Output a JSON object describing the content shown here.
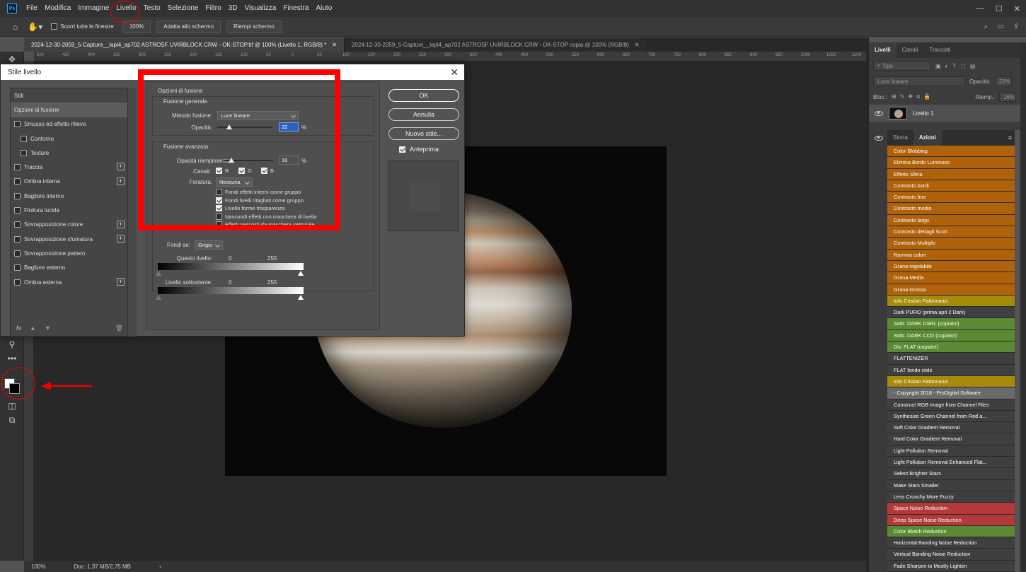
{
  "menubar": {
    "logo": "Ps",
    "items": [
      "File",
      "Modifica",
      "Immagine",
      "Livello",
      "Testo",
      "Selezione",
      "Filtro",
      "3D",
      "Visualizza",
      "Finestra",
      "Aiuto"
    ]
  },
  "options": {
    "scroll_all": "Scorri tutte le finestre",
    "zoom": "100%",
    "fit_screen": "Adatta allo schermo",
    "fill_screen": "Riempi schermo"
  },
  "tabs": [
    {
      "label": "2024-12-30-2059_5-Capture__lapl4_ap702 ASTROSF UVIRBLOCK CRW - OK-STOP.tif @ 100% (Livello 1, RGB/8) *",
      "active": true
    },
    {
      "label": "2024-12-30-2059_5-Capture__lapl4_ap702 ASTROSF UVIRBLOCK CRW - OK-STOP copia @ 100% (RGB/8)",
      "active": false
    }
  ],
  "ruler_ticks": [
    "500",
    "450",
    "400",
    "350",
    "300",
    "250",
    "200",
    "150",
    "100",
    "50",
    "0",
    "50",
    "100",
    "150",
    "200",
    "250",
    "300",
    "350",
    "400",
    "450",
    "500",
    "550",
    "600",
    "650",
    "700",
    "750",
    "800",
    "850",
    "900",
    "950",
    "1000",
    "1050",
    "1100"
  ],
  "status": {
    "zoom": "100%",
    "doc": "Doc: 1,37 MB/2,75 MB"
  },
  "layers_panel": {
    "tabs": [
      "Livelli",
      "Canali",
      "Tracciati"
    ],
    "filter_placeholder": "Tipo",
    "blend_mode": "Luce lineare",
    "opacity_label": "Opacità:",
    "opacity_value": "22%",
    "lock_label": "Bloc.:",
    "fill_label": "Riemp.:",
    "fill_value": "16%",
    "layer_name": "Livello 1"
  },
  "actions_panel": {
    "tabs": [
      "Storia",
      "Azioni"
    ],
    "items": [
      {
        "label": "Color Blobbing",
        "color": "#b0620b"
      },
      {
        "label": "Elimina Bordo Luminoso",
        "color": "#b0620b"
      },
      {
        "label": "Effetto Sfera",
        "color": "#b0620b"
      },
      {
        "label": "Contrasto bordi",
        "color": "#b0620b"
      },
      {
        "label": "Contrasto fine",
        "color": "#b0620b"
      },
      {
        "label": "Contrasto medio",
        "color": "#b0620b"
      },
      {
        "label": "Contrasto largo",
        "color": "#b0620b"
      },
      {
        "label": "Contrasto dettagli Scuri",
        "color": "#b0620b"
      },
      {
        "label": "Contrasto Multiplo",
        "color": "#b0620b"
      },
      {
        "label": "Ravviva colori",
        "color": "#b0620b"
      },
      {
        "label": "Grana regolabile",
        "color": "#b0620b"
      },
      {
        "label": "Grana Media",
        "color": "#b0620b"
      },
      {
        "label": "Grana Grossa",
        "color": "#b0620b"
      },
      {
        "label": "Info Cristian Fattinnanzi",
        "color": "#a68a0a"
      },
      {
        "label": "Dark PURO (prima apri 2 Dark)",
        "color": "#3f3f3f"
      },
      {
        "label": "Sottr. DARK DSRL (copialo!)",
        "color": "#5c8a34"
      },
      {
        "label": "Sottr. DARK CCD (copialo!)",
        "color": "#5c8a34"
      },
      {
        "label": "Div. FLAT (copialo!)",
        "color": "#5c8a34"
      },
      {
        "label": "FLATTENIZER",
        "color": "#3f3f3f"
      },
      {
        "label": "FLAT fondo cielo",
        "color": "#3f3f3f"
      },
      {
        "label": "Info Cristian Fattinnanzi",
        "color": "#a68a0a"
      },
      {
        "label": "- Copyright 2018 - ProDigital Software",
        "color": "#6a6a6a"
      },
      {
        "label": "Construct RGB Image from Channel Files",
        "color": "#3f3f3f"
      },
      {
        "label": "Synthesize Green Channel from Red a...",
        "color": "#3f3f3f"
      },
      {
        "label": "Soft Color Gradient Removal",
        "color": "#3f3f3f"
      },
      {
        "label": "Hard Color Gradient Removal",
        "color": "#3f3f3f"
      },
      {
        "label": "Light Pollution Removal",
        "color": "#3f3f3f"
      },
      {
        "label": "Light Pollution Removal Enhanced Flat...",
        "color": "#3f3f3f"
      },
      {
        "label": "Select Brighter Stars",
        "color": "#3f3f3f"
      },
      {
        "label": "Make Stars Smaller",
        "color": "#3f3f3f"
      },
      {
        "label": "Less Crunchy More Fuzzy",
        "color": "#3f3f3f"
      },
      {
        "label": "Space Noise Reduction",
        "color": "#b33a3a"
      },
      {
        "label": "Deep Space Noise Reduction",
        "color": "#b33a3a"
      },
      {
        "label": "Color Blotch Reduction",
        "color": "#5c8a34"
      },
      {
        "label": "Horizontal Banding Noise Reduction",
        "color": "#3f3f3f"
      },
      {
        "label": "Vertical Banding Noise Reduction",
        "color": "#3f3f3f"
      },
      {
        "label": "Fade Sharpen to Mostly Lighten",
        "color": "#3f3f3f"
      }
    ]
  },
  "dialog": {
    "title": "Stile livello",
    "styles": [
      {
        "label": "Stili",
        "checkbox": false,
        "sub": false,
        "plus": false,
        "selected": false
      },
      {
        "label": "Opzioni di fusione",
        "checkbox": false,
        "sub": false,
        "plus": false,
        "selected": true
      },
      {
        "label": "Smusso ed effetto rilievo",
        "checkbox": true,
        "sub": false,
        "plus": false,
        "selected": false
      },
      {
        "label": "Contorno",
        "checkbox": true,
        "sub": true,
        "plus": false,
        "selected": false
      },
      {
        "label": "Texture",
        "checkbox": true,
        "sub": true,
        "plus": false,
        "selected": false
      },
      {
        "label": "Traccia",
        "checkbox": true,
        "sub": false,
        "plus": true,
        "selected": false
      },
      {
        "label": "Ombra interna",
        "checkbox": true,
        "sub": false,
        "plus": true,
        "selected": false
      },
      {
        "label": "Bagliore interno",
        "checkbox": true,
        "sub": false,
        "plus": false,
        "selected": false
      },
      {
        "label": "Finitura lucida",
        "checkbox": true,
        "sub": false,
        "plus": false,
        "selected": false
      },
      {
        "label": "Sovrapposizione colore",
        "checkbox": true,
        "sub": false,
        "plus": true,
        "selected": false
      },
      {
        "label": "Sovrapposizione sfumatura",
        "checkbox": true,
        "sub": false,
        "plus": true,
        "selected": false
      },
      {
        "label": "Sovrapposizione pattern",
        "checkbox": true,
        "sub": false,
        "plus": false,
        "selected": false
      },
      {
        "label": "Bagliore esterno",
        "checkbox": true,
        "sub": false,
        "plus": false,
        "selected": false
      },
      {
        "label": "Ombra esterna",
        "checkbox": true,
        "sub": false,
        "plus": true,
        "selected": false
      }
    ],
    "fx_label": "fx",
    "blend_options_title": "Opzioni di fusione",
    "general_title": "Fusione generale",
    "blend_mode_label": "Metodo fusione:",
    "blend_mode_value": "Luce lineare",
    "opacity_label": "Opacità:",
    "opacity_value": "22",
    "opacity_fraction": 0.22,
    "percent": "%",
    "advanced_title": "Fusione avanzata",
    "fill_opacity_label": "Opacità riempimento:",
    "fill_opacity_value": "16",
    "fill_fraction": 0.16,
    "channels_label": "Canali:",
    "channels": [
      "R",
      "G",
      "B"
    ],
    "knockout_label": "Foratura:",
    "knockout_value": "Nessuna",
    "checks": [
      {
        "label": "Fondi effetti interni come gruppo",
        "checked": false
      },
      {
        "label": "Fondi livelli ritagliati come gruppo",
        "checked": true
      },
      {
        "label": "Livello forme trasparenza",
        "checked": true
      },
      {
        "label": "Nascondi effetti con maschera di livello",
        "checked": false
      },
      {
        "label": "Effetti nascosti da maschera vettoriale",
        "checked": false
      }
    ],
    "blend_if_label": "Fondi se:",
    "blend_if_value": "Grigio",
    "this_layer_label": "Questo livello:",
    "underlying_label": "Livello sottostante:",
    "range_min": "0",
    "range_max": "255",
    "ok": "OK",
    "cancel": "Annulla",
    "new_style": "Nuovo stile...",
    "preview": "Anteprima"
  }
}
